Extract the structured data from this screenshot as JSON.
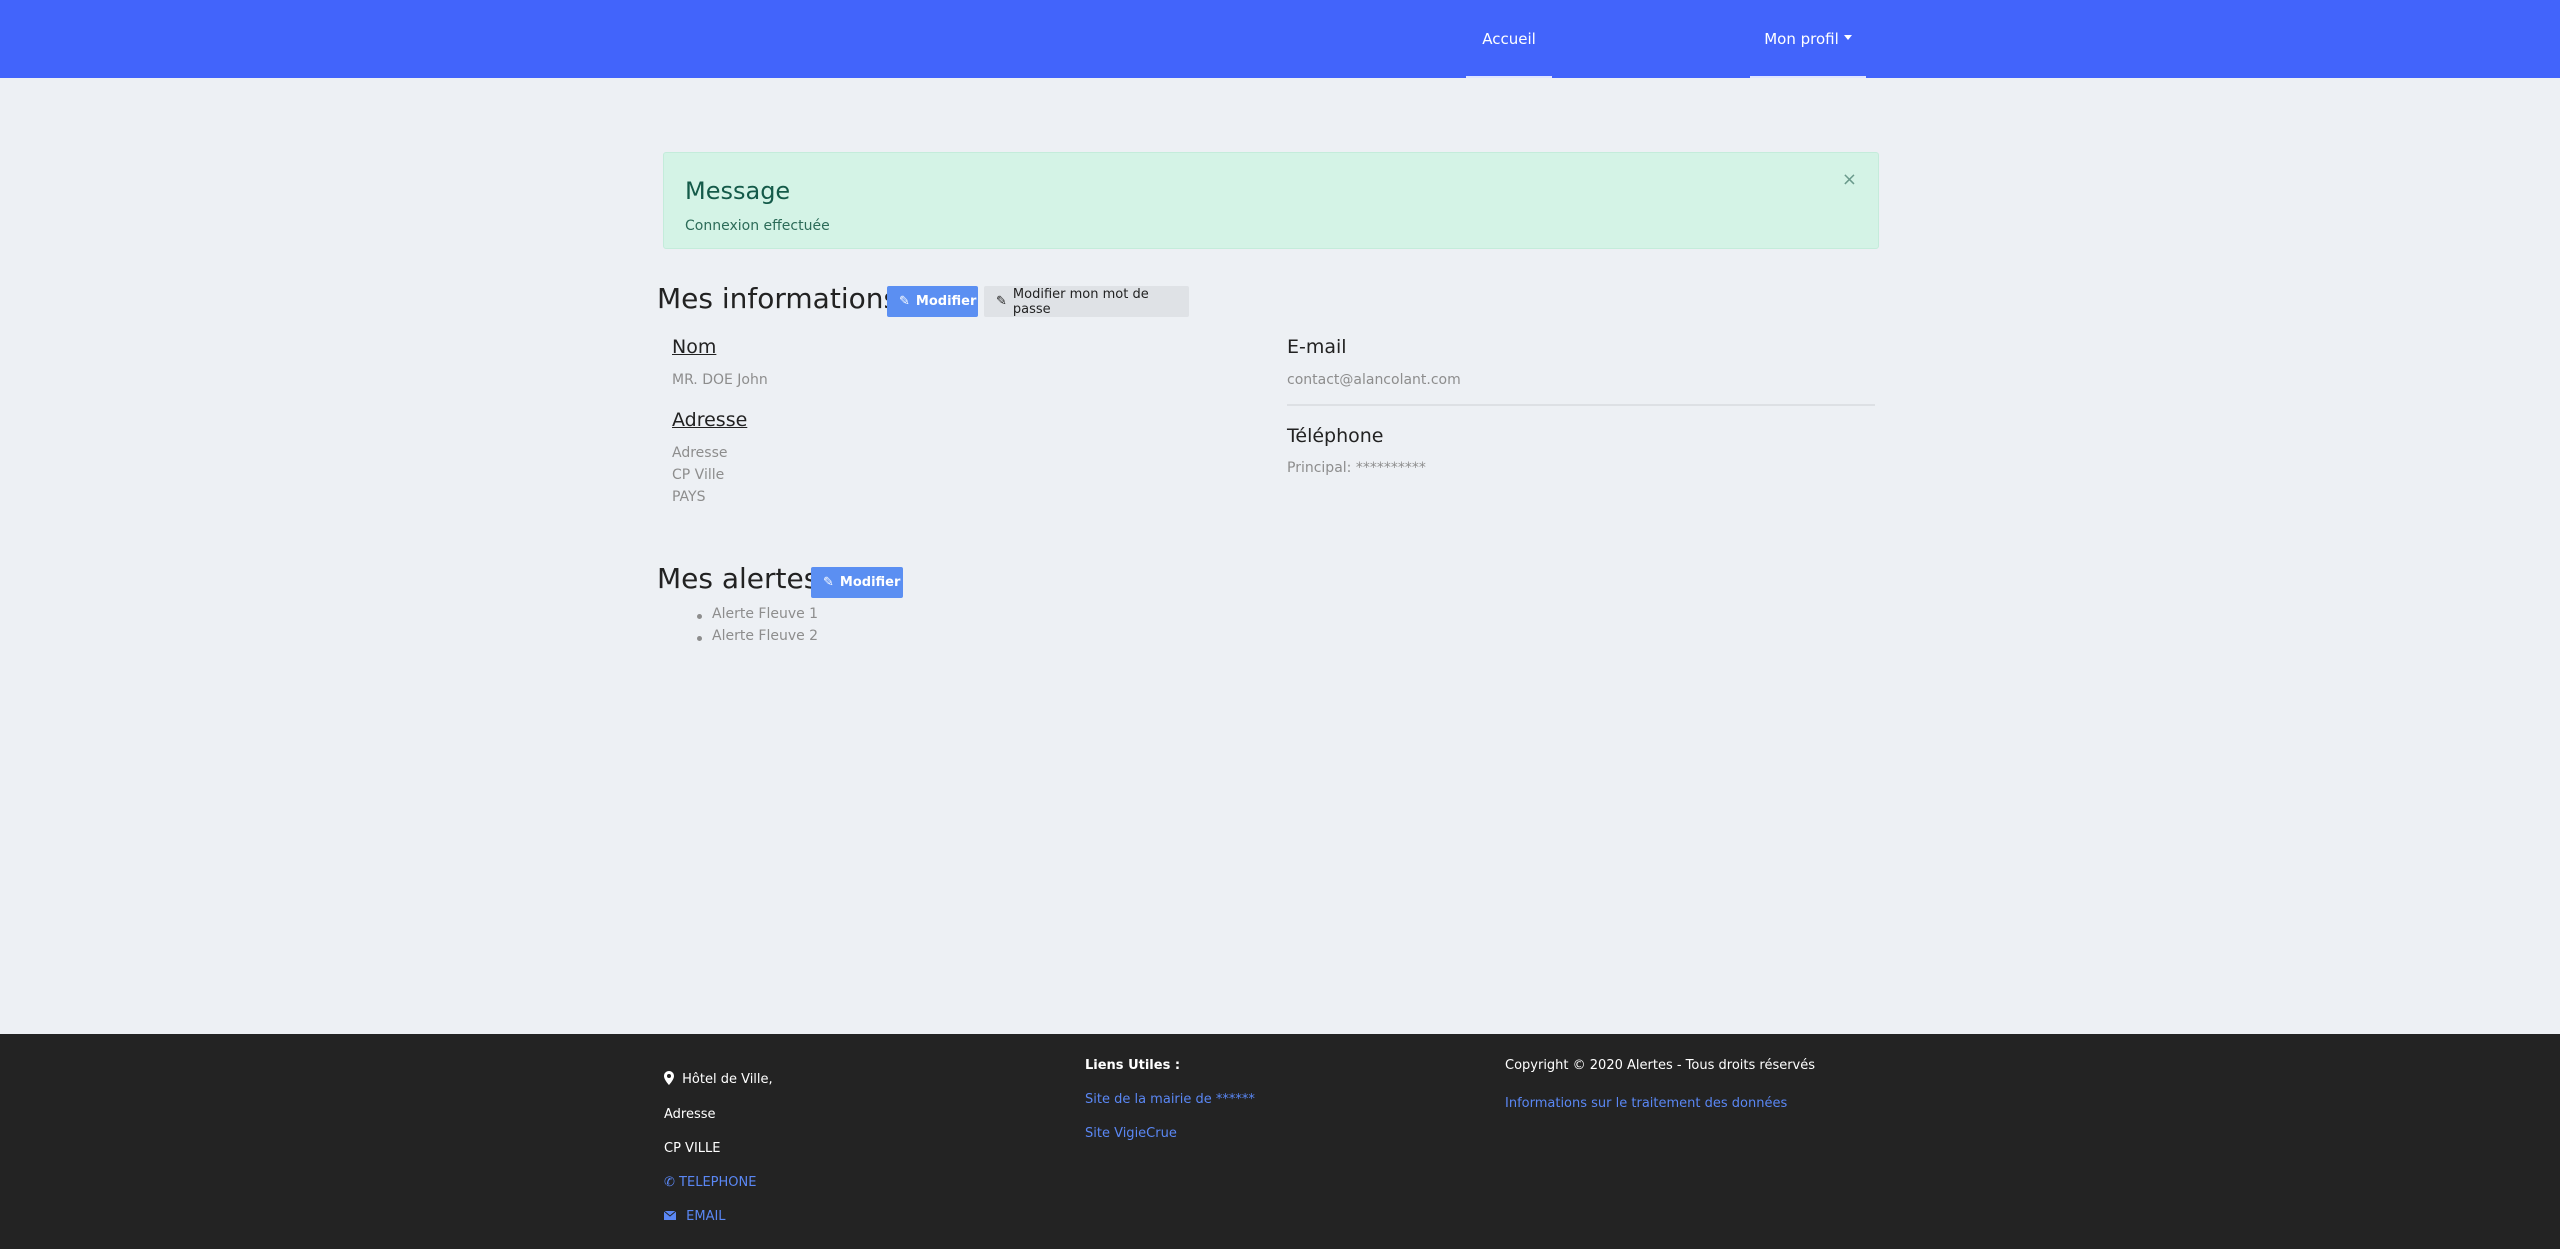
{
  "nav": {
    "home": "Accueil",
    "profile": "Mon profil"
  },
  "alert": {
    "title": "Message",
    "text": "Connexion effectuée",
    "close": "×"
  },
  "info": {
    "heading": "Mes informations",
    "edit_button": "Modifier",
    "password_button": "Modifier mon mot de passe",
    "nom_label": "Nom",
    "nom_value": "MR. DOE John",
    "adresse_label": "Adresse",
    "adresse_lines": [
      "Adresse",
      "CP Ville",
      "PAYS"
    ],
    "email_label": "E-mail",
    "email_value": "contact@alancolant.com",
    "phone_label": "Téléphone",
    "phone_value": "Principal: **********"
  },
  "alerts": {
    "heading": "Mes alertes",
    "edit_button": "Modifier",
    "items": [
      "Alerte Fleuve 1",
      "Alerte Fleuve 2"
    ]
  },
  "footer": {
    "address_title": "Hôtel de Ville,",
    "address_line1": "Adresse",
    "address_line2": "CP VILLE",
    "telephone": "TELEPHONE",
    "email": "EMAIL",
    "links_title": "Liens Utiles :",
    "link1": "Site de la mairie de ******",
    "link2": "Site VigieCrue",
    "copyright": "Copyright © 2020 Alertes - Tous droits réservés",
    "privacy": "Informations sur le traitement des données"
  },
  "colors": {
    "navbar": "#4264fb",
    "alert_bg": "#d4f3e6",
    "primary_button": "#5b8ff2",
    "footer_bg": "#232323",
    "footer_link": "#5a87f4"
  },
  "icons": {
    "edit": "pencil-icon",
    "close": "close-icon",
    "location": "map-marker-icon",
    "phone": "phone-icon",
    "email": "envelope-icon"
  }
}
